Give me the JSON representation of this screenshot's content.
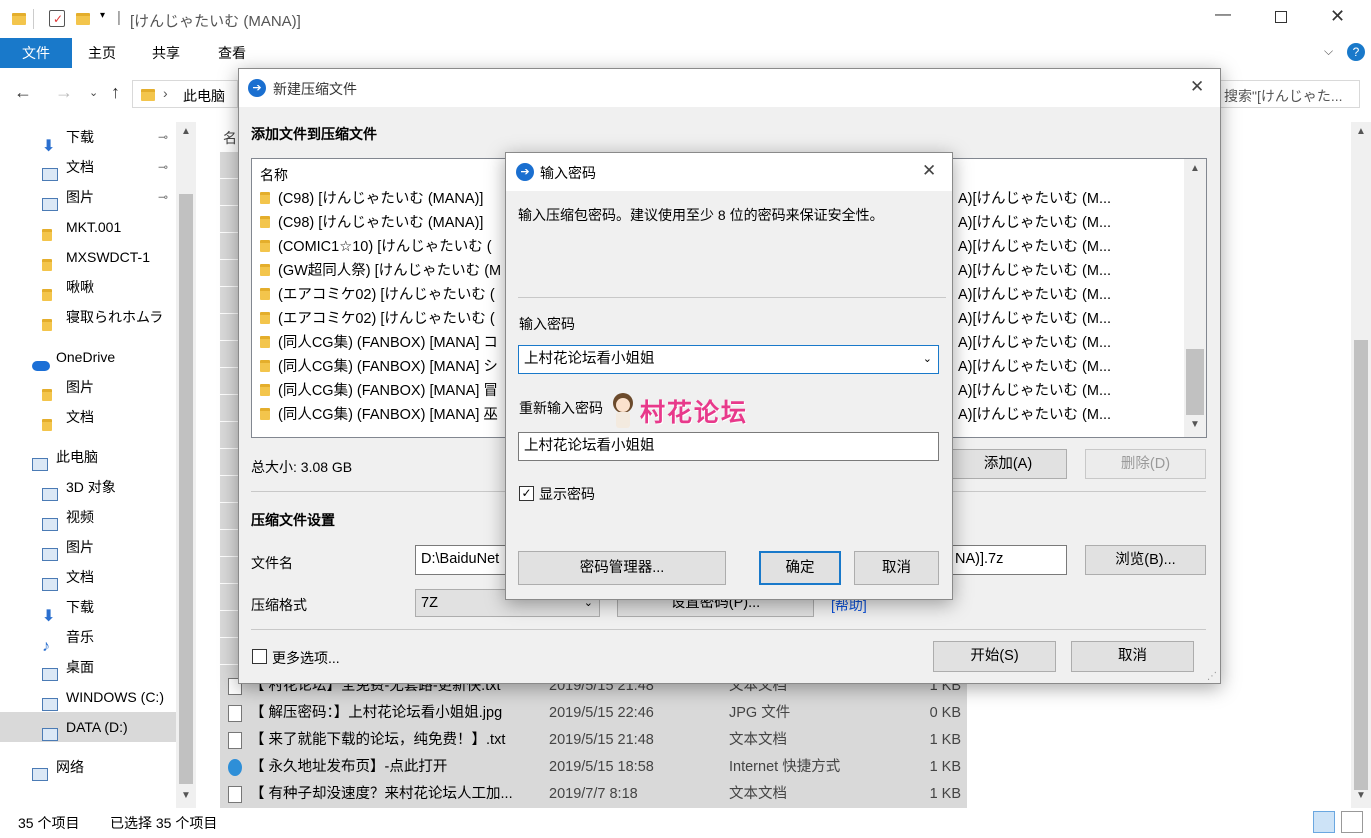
{
  "window": {
    "title": "[けんじゃたいむ (MANA)]",
    "tabs": [
      "文件",
      "主页",
      "共享",
      "查看"
    ]
  },
  "address": {
    "crumb": "此电脑",
    "search_placeholder": "搜索\"[けんじゃた..."
  },
  "sidebar": {
    "items": [
      {
        "label": "下载",
        "icon": "download-icon",
        "pinned": true
      },
      {
        "label": "文档",
        "icon": "document-icon",
        "pinned": true
      },
      {
        "label": "图片",
        "icon": "picture-icon",
        "pinned": true
      },
      {
        "label": "MKT.001",
        "icon": "folder-icon"
      },
      {
        "label": "MXSWDCT-1",
        "icon": "folder-icon"
      },
      {
        "label": "啾啾",
        "icon": "folder-icon"
      },
      {
        "label": "寝取られホムラ",
        "icon": "folder-icon"
      },
      {
        "label": "OneDrive",
        "icon": "cloud-icon"
      },
      {
        "label": "图片",
        "icon": "folder-icon"
      },
      {
        "label": "文档",
        "icon": "folder-icon"
      },
      {
        "label": "此电脑",
        "icon": "computer-icon"
      },
      {
        "label": "3D 对象",
        "icon": "cube-icon"
      },
      {
        "label": "视频",
        "icon": "film-icon"
      },
      {
        "label": "图片",
        "icon": "picture-icon"
      },
      {
        "label": "文档",
        "icon": "document-icon"
      },
      {
        "label": "下载",
        "icon": "download-icon"
      },
      {
        "label": "音乐",
        "icon": "music-icon"
      },
      {
        "label": "桌面",
        "icon": "desktop-icon"
      },
      {
        "label": "WINDOWS (C:)",
        "icon": "drive-icon"
      },
      {
        "label": "DATA (D:)",
        "icon": "drive-icon"
      },
      {
        "label": "网络",
        "icon": "network-icon"
      }
    ]
  },
  "files_header": "名",
  "files": [
    {
      "name": "【 村花论坛】全免费-无套路-更新快.txt",
      "date": "2019/5/15 21:48",
      "type": "文本文档",
      "size": "1 KB"
    },
    {
      "name": "【 解压密码：】上村花论坛看小姐姐.jpg",
      "date": "2019/5/15 22:46",
      "type": "JPG 文件",
      "size": "0 KB"
    },
    {
      "name": "【 来了就能下载的论坛，纯免费！】.txt",
      "date": "2019/5/15 21:48",
      "type": "文本文档",
      "size": "1 KB"
    },
    {
      "name": "【 永久地址发布页】-点此打开",
      "date": "2019/5/15 18:58",
      "type": "Internet 快捷方式",
      "size": "1 KB"
    },
    {
      "name": "【 有种子却没速度？来村花论坛人工加...",
      "date": "2019/7/7 8:18",
      "type": "文本文档",
      "size": "1 KB"
    }
  ],
  "status": {
    "count": "35 个项目",
    "selected": "已选择 35 个项目"
  },
  "archive_dialog": {
    "title": "新建压缩文件",
    "section_add": "添加文件到压缩文件",
    "col_name": "名称",
    "rows": [
      "(C98) [けんじゃたいむ (MANA)]",
      "(C98) [けんじゃたいむ (MANA)]",
      "(COMIC1☆10) [けんじゃたいむ (",
      "(GW超同人祭) [けんじゃたいむ (M",
      "(エアコミケ02) [けんじゃたいむ (",
      "(エアコミケ02) [けんじゃたいむ (",
      "(同人CG集) (FANBOX) [MANA] コ",
      "(同人CG集) (FANBOX) [MANA] シ",
      "(同人CG集) (FANBOX) [MANA] 冒",
      "(同人CG集) (FANBOX) [MANA] 巫"
    ],
    "right_col": "A)[けんじゃたいむ (M...",
    "total": "总大小: 3.08 GB",
    "add_btn": "添加(A)",
    "delete_btn": "删除(D)",
    "section_settings": "压缩文件设置",
    "filename_label": "文件名",
    "filename_value": "D:\\BaiduNet",
    "filename_suffix": "NA)].7z",
    "browse_btn": "浏览(B)...",
    "format_label": "压缩格式",
    "format_value": "7Z",
    "set_password_btn": "设置密码(P)...",
    "help_link": "[帮助]",
    "more_options": "更多选项...",
    "start_btn": "开始(S)",
    "cancel_btn": "取消"
  },
  "password_dialog": {
    "title": "输入密码",
    "description": "输入压缩包密码。建议使用至少 8 位的密码来保证安全性。",
    "label_password": "输入密码",
    "password_value": "上村花论坛看小姐姐",
    "label_repeat": "重新输入密码",
    "repeat_value": "上村花论坛看小姐姐",
    "show_password": "显示密码",
    "manager_btn": "密码管理器...",
    "ok_btn": "确定",
    "cancel_btn": "取消"
  },
  "watermark": "村花论坛",
  "colors": {
    "accent": "#1979ca",
    "watermark": "#e8398b"
  }
}
